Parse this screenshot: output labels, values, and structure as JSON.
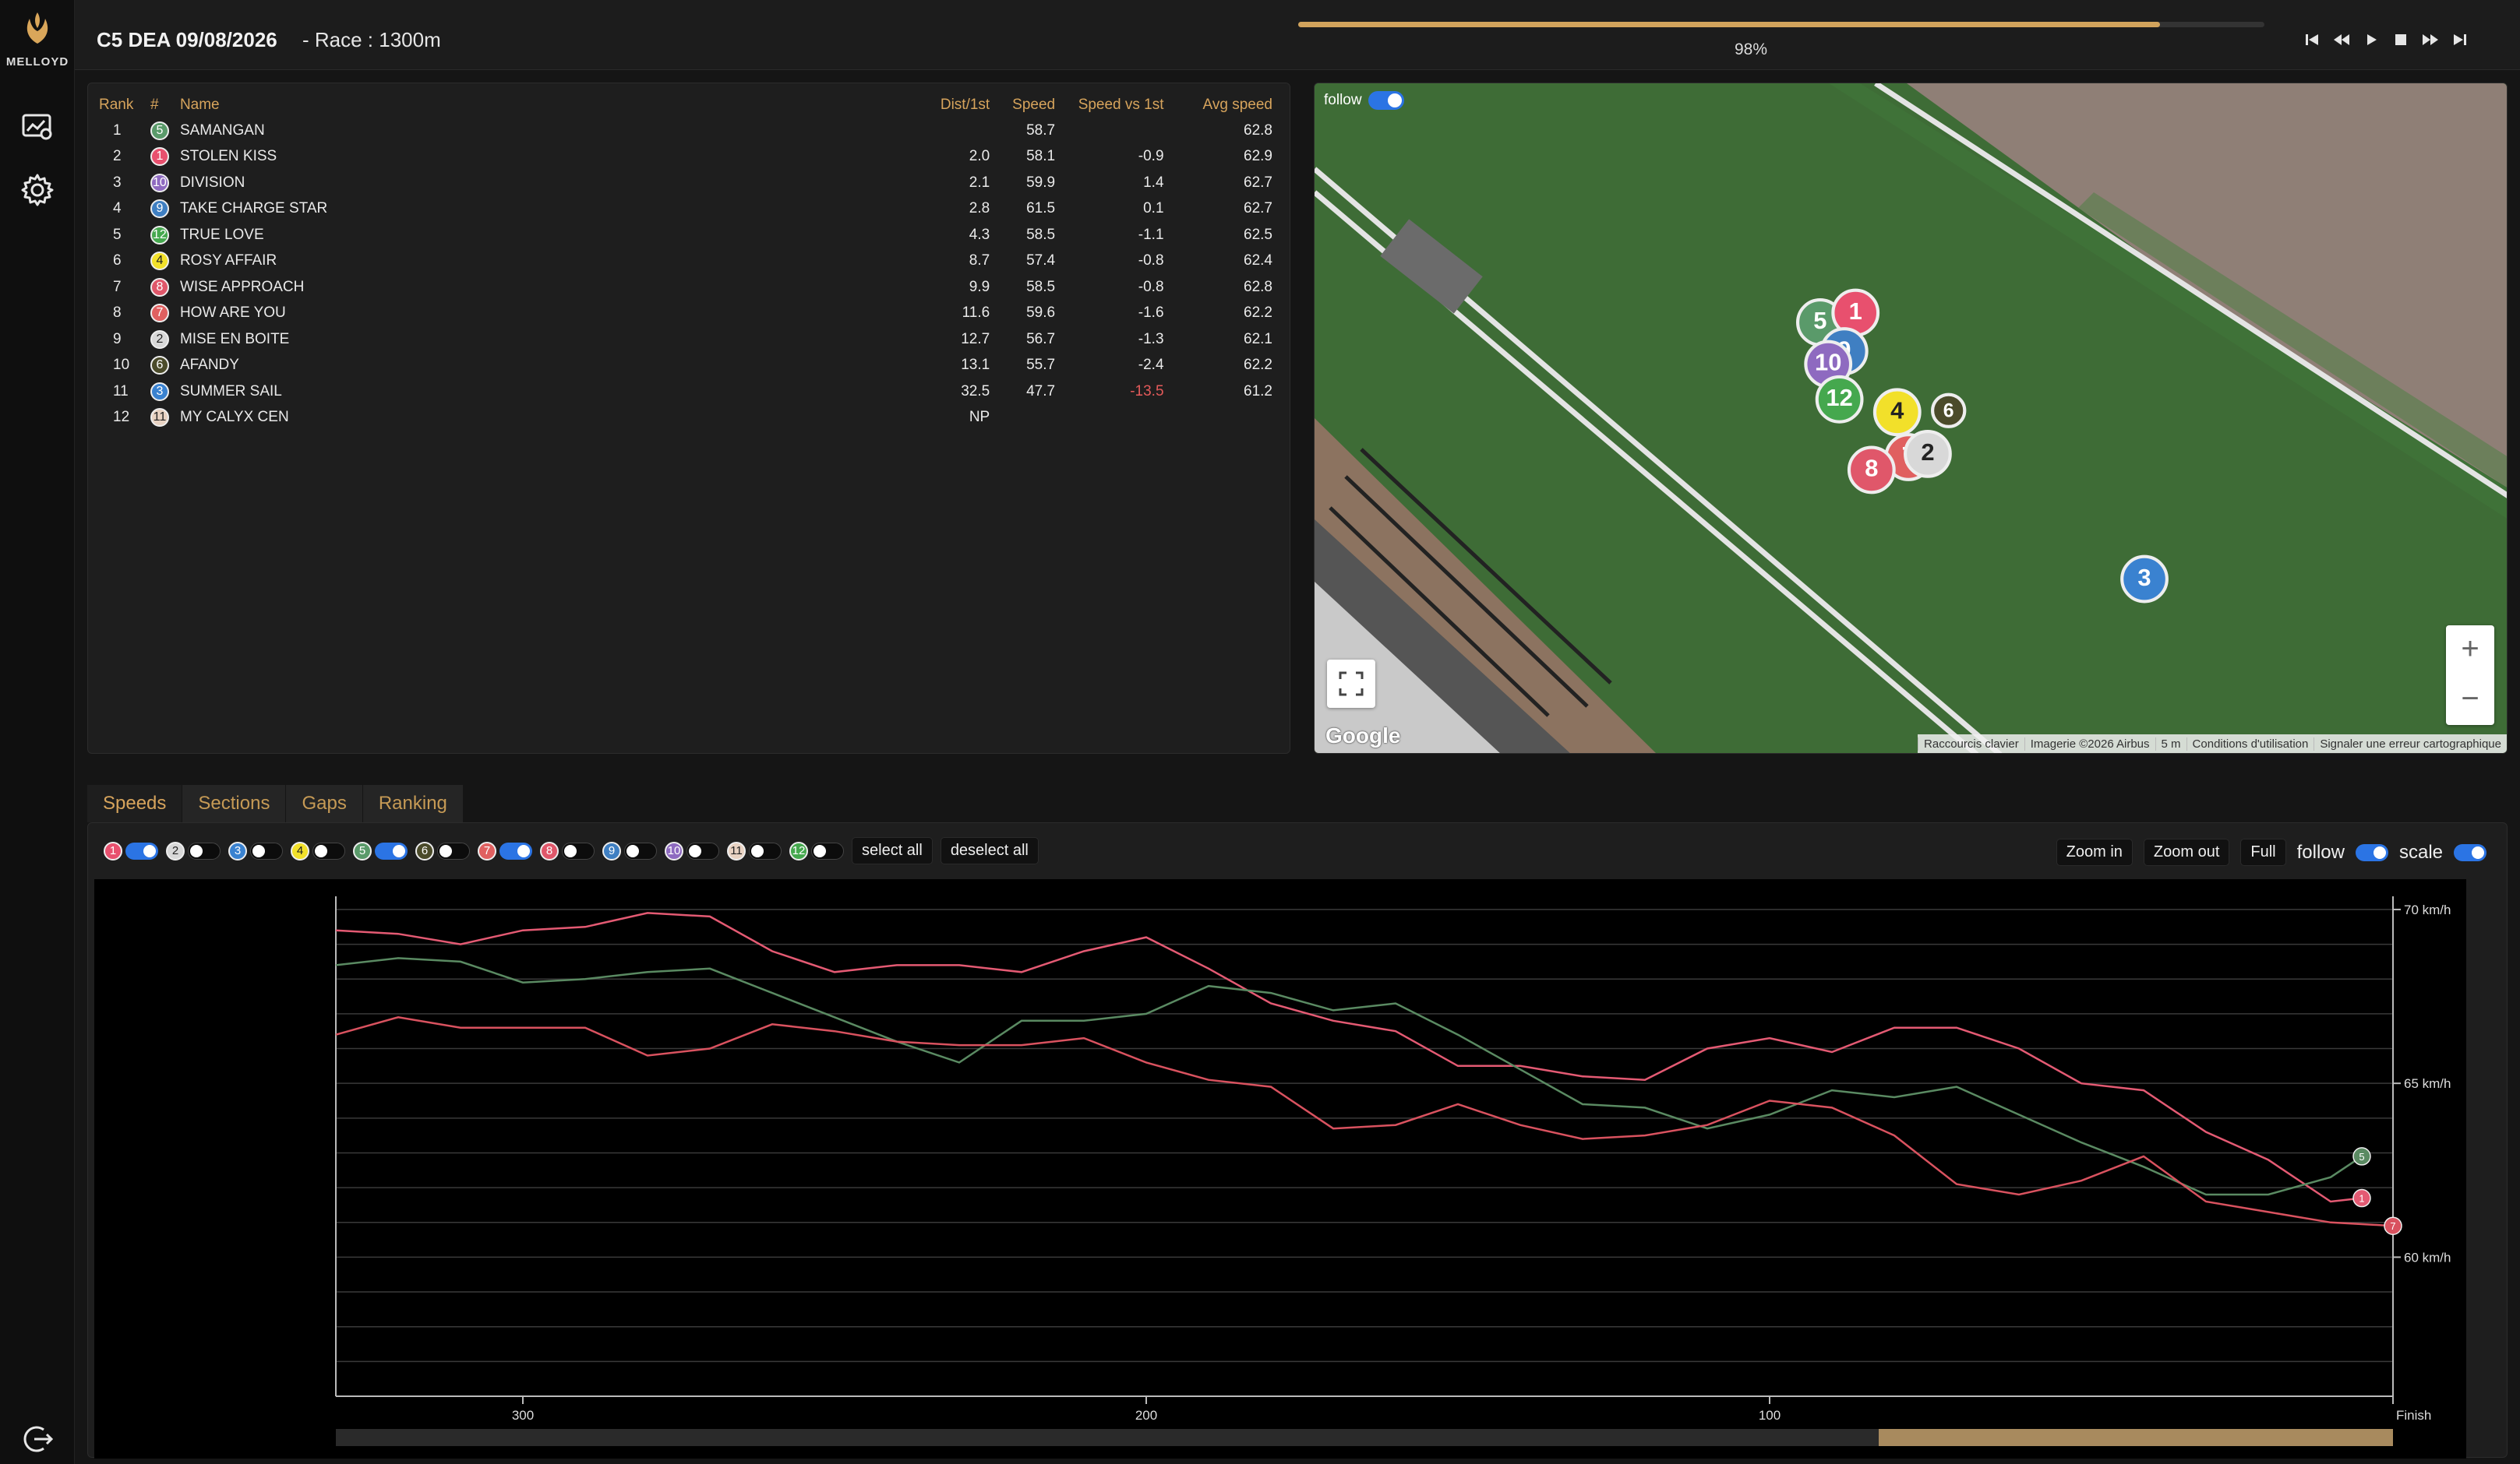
{
  "app": {
    "brand": "MELLOYD",
    "race_title": "C5 DEA 09/08/2026",
    "race_subtitle": "- Race : 1300m",
    "progress_percent": 98,
    "progress_label": "98%"
  },
  "sidebar": {
    "items": [
      {
        "name": "monitor-icon"
      },
      {
        "name": "gear-icon"
      },
      {
        "name": "logout-icon"
      }
    ]
  },
  "player": {
    "buttons": [
      "skip-start",
      "rewind",
      "play",
      "stop",
      "fast-forward",
      "skip-end"
    ]
  },
  "ranking": {
    "headers": {
      "rank": "Rank",
      "num": "#",
      "name": "Name",
      "dist": "Dist/1st",
      "speed": "Speed",
      "speed_vs_1st": "Speed vs 1st",
      "avg_speed": "Avg speed"
    },
    "rows": [
      {
        "rank": "1",
        "num": "5",
        "color": "#5a9a6a",
        "name": "SAMANGAN",
        "dist": "",
        "speed": "58.7",
        "speed_vs_1st": "",
        "avg_speed": "62.8"
      },
      {
        "rank": "2",
        "num": "1",
        "color": "#e8506e",
        "name": "STOLEN KISS",
        "dist": "2.0",
        "speed": "58.1",
        "speed_vs_1st": "-0.9",
        "avg_speed": "62.9"
      },
      {
        "rank": "3",
        "num": "10",
        "color": "#8e6ac0",
        "name": "DIVISION",
        "dist": "2.1",
        "speed": "59.9",
        "speed_vs_1st": "1.4",
        "avg_speed": "62.7"
      },
      {
        "rank": "4",
        "num": "9",
        "color": "#3f7fc2",
        "name": "TAKE CHARGE STAR",
        "dist": "2.8",
        "speed": "61.5",
        "speed_vs_1st": "0.1",
        "avg_speed": "62.7"
      },
      {
        "rank": "5",
        "num": "12",
        "color": "#45a84e",
        "name": "TRUE LOVE",
        "dist": "4.3",
        "speed": "58.5",
        "speed_vs_1st": "-1.1",
        "avg_speed": "62.5"
      },
      {
        "rank": "6",
        "num": "4",
        "color": "#f2e02a",
        "name": "ROSY AFFAIR",
        "dist": "8.7",
        "speed": "57.4",
        "speed_vs_1st": "-0.8",
        "avg_speed": "62.4"
      },
      {
        "rank": "7",
        "num": "8",
        "color": "#e0576a",
        "name": "WISE APPROACH",
        "dist": "9.9",
        "speed": "58.5",
        "speed_vs_1st": "-0.8",
        "avg_speed": "62.8"
      },
      {
        "rank": "8",
        "num": "7",
        "color": "#e06060",
        "name": "HOW ARE YOU",
        "dist": "11.6",
        "speed": "59.6",
        "speed_vs_1st": "-1.6",
        "avg_speed": "62.2"
      },
      {
        "rank": "9",
        "num": "2",
        "color": "#d8d8d8",
        "name": "MISE EN BOITE",
        "dist": "12.7",
        "speed": "56.7",
        "speed_vs_1st": "-1.3",
        "avg_speed": "62.1"
      },
      {
        "rank": "10",
        "num": "6",
        "color": "#4b4b2a",
        "name": "AFANDY",
        "dist": "13.1",
        "speed": "55.7",
        "speed_vs_1st": "-2.4",
        "avg_speed": "62.2"
      },
      {
        "rank": "11",
        "num": "3",
        "color": "#3a82d0",
        "name": "SUMMER SAIL",
        "dist": "32.5",
        "speed": "47.7",
        "speed_vs_1st": "-13.5",
        "avg_speed": "61.2",
        "highlight": true
      },
      {
        "rank": "12",
        "num": "11",
        "color": "#e8d2c2",
        "name": "MY CALYX CEN",
        "dist": "NP",
        "speed": "",
        "speed_vs_1st": "",
        "avg_speed": ""
      }
    ]
  },
  "map": {
    "follow_label": "follow",
    "google_label": "Google",
    "attribution": [
      "Raccourcis clavier",
      "Imagerie ©2026 Airbus",
      "5 m",
      "Conditions d'utilisation",
      "Signaler une erreur cartographique"
    ],
    "markers": [
      {
        "num": "5",
        "color": "#5a9a6a"
      },
      {
        "num": "1",
        "color": "#e8506e"
      },
      {
        "num": "9",
        "color": "#3f7fc2"
      },
      {
        "num": "10",
        "color": "#8e6ac0"
      },
      {
        "num": "12",
        "color": "#45a84e"
      },
      {
        "num": "4",
        "color": "#f2e02a"
      },
      {
        "num": "6",
        "color": "#4b4b2a"
      },
      {
        "num": "7",
        "color": "#e06060"
      },
      {
        "num": "2",
        "color": "#d8d8d8"
      },
      {
        "num": "8",
        "color": "#e0576a"
      },
      {
        "num": "3",
        "color": "#3a82d0"
      }
    ]
  },
  "tabs": [
    {
      "label": "Speeds",
      "active": true
    },
    {
      "label": "Sections",
      "active": false
    },
    {
      "label": "Gaps",
      "active": false
    },
    {
      "label": "Ranking",
      "active": false
    }
  ],
  "filters": {
    "horses": [
      {
        "num": "1",
        "color": "#e8506e",
        "on": true
      },
      {
        "num": "2",
        "color": "#d8d8d8",
        "on": false
      },
      {
        "num": "3",
        "color": "#3a82d0",
        "on": false
      },
      {
        "num": "4",
        "color": "#f2e02a",
        "on": false
      },
      {
        "num": "5",
        "color": "#5a9a6a",
        "on": true
      },
      {
        "num": "6",
        "color": "#4b4b2a",
        "on": false
      },
      {
        "num": "7",
        "color": "#e06060",
        "on": true
      },
      {
        "num": "8",
        "color": "#e0576a",
        "on": false
      },
      {
        "num": "9",
        "color": "#3f7fc2",
        "on": false
      },
      {
        "num": "10",
        "color": "#8e6ac0",
        "on": false
      },
      {
        "num": "11",
        "color": "#e8d2c2",
        "on": false
      },
      {
        "num": "12",
        "color": "#45a84e",
        "on": false
      }
    ],
    "select_all": "select all",
    "deselect_all": "deselect all"
  },
  "chart_controls": {
    "zoom_in": "Zoom in",
    "zoom_out": "Zoom out",
    "full": "Full",
    "follow": "follow",
    "scale": "scale"
  },
  "chart_data": {
    "type": "line",
    "xlabel": "",
    "ylabel": "",
    "xlim": [
      330,
      0
    ],
    "ylim": [
      56,
      70.2
    ],
    "x_ticks": [
      300,
      200,
      100,
      0
    ],
    "x_tick_labels": [
      "300",
      "200",
      "100",
      "Finish"
    ],
    "y_ticks": [
      70,
      65,
      60
    ],
    "y_tick_labels": [
      "70 km/h",
      "65 km/h",
      "60 km/h"
    ],
    "grid": true,
    "range_slider": {
      "start_fraction": 0.75,
      "end_fraction": 1.0
    },
    "series": [
      {
        "color": "#e45a73",
        "end_marker": "1",
        "points": [
          [
            330,
            69.4
          ],
          [
            320,
            69.3
          ],
          [
            310,
            69.0
          ],
          [
            300,
            69.4
          ],
          [
            290,
            69.5
          ],
          [
            280,
            69.9
          ],
          [
            270,
            69.8
          ],
          [
            260,
            68.8
          ],
          [
            250,
            68.2
          ],
          [
            240,
            68.4
          ],
          [
            230,
            68.4
          ],
          [
            220,
            68.2
          ],
          [
            210,
            68.8
          ],
          [
            200,
            69.2
          ],
          [
            190,
            68.3
          ],
          [
            180,
            67.3
          ],
          [
            170,
            66.8
          ],
          [
            160,
            66.5
          ],
          [
            150,
            65.5
          ],
          [
            140,
            65.5
          ],
          [
            130,
            65.2
          ],
          [
            120,
            65.1
          ],
          [
            110,
            66.0
          ],
          [
            100,
            66.3
          ],
          [
            90,
            65.9
          ],
          [
            80,
            66.6
          ],
          [
            70,
            66.6
          ],
          [
            60,
            66.0
          ],
          [
            50,
            65.0
          ],
          [
            40,
            64.8
          ],
          [
            30,
            63.6
          ],
          [
            20,
            62.8
          ],
          [
            10,
            61.6
          ],
          [
            5,
            61.7
          ]
        ]
      },
      {
        "color": "#5a8a62",
        "end_marker": "5",
        "points": [
          [
            330,
            68.4
          ],
          [
            320,
            68.6
          ],
          [
            310,
            68.5
          ],
          [
            300,
            67.9
          ],
          [
            290,
            68.0
          ],
          [
            280,
            68.2
          ],
          [
            270,
            68.3
          ],
          [
            260,
            67.6
          ],
          [
            250,
            66.9
          ],
          [
            240,
            66.2
          ],
          [
            230,
            65.6
          ],
          [
            220,
            66.8
          ],
          [
            210,
            66.8
          ],
          [
            200,
            67.0
          ],
          [
            190,
            67.8
          ],
          [
            180,
            67.6
          ],
          [
            170,
            67.1
          ],
          [
            160,
            67.3
          ],
          [
            150,
            66.4
          ],
          [
            140,
            65.4
          ],
          [
            130,
            64.4
          ],
          [
            120,
            64.3
          ],
          [
            110,
            63.7
          ],
          [
            100,
            64.1
          ],
          [
            90,
            64.8
          ],
          [
            80,
            64.6
          ],
          [
            70,
            64.9
          ],
          [
            60,
            64.1
          ],
          [
            50,
            63.3
          ],
          [
            40,
            62.6
          ],
          [
            30,
            61.8
          ],
          [
            20,
            61.8
          ],
          [
            10,
            62.3
          ],
          [
            5,
            62.9
          ]
        ]
      },
      {
        "color": "#d9525f",
        "end_marker": "7",
        "points": [
          [
            330,
            66.4
          ],
          [
            320,
            66.9
          ],
          [
            310,
            66.6
          ],
          [
            300,
            66.6
          ],
          [
            290,
            66.6
          ],
          [
            280,
            65.8
          ],
          [
            270,
            66.0
          ],
          [
            260,
            66.7
          ],
          [
            250,
            66.5
          ],
          [
            240,
            66.2
          ],
          [
            230,
            66.1
          ],
          [
            220,
            66.1
          ],
          [
            210,
            66.3
          ],
          [
            200,
            65.6
          ],
          [
            190,
            65.1
          ],
          [
            180,
            64.9
          ],
          [
            170,
            63.7
          ],
          [
            160,
            63.8
          ],
          [
            150,
            64.4
          ],
          [
            140,
            63.8
          ],
          [
            130,
            63.4
          ],
          [
            120,
            63.5
          ],
          [
            110,
            63.8
          ],
          [
            100,
            64.5
          ],
          [
            90,
            64.3
          ],
          [
            80,
            63.5
          ],
          [
            70,
            62.1
          ],
          [
            60,
            61.8
          ],
          [
            50,
            62.2
          ],
          [
            40,
            62.9
          ],
          [
            30,
            61.6
          ],
          [
            20,
            61.3
          ],
          [
            10,
            61.0
          ],
          [
            0,
            60.9
          ]
        ]
      }
    ]
  }
}
